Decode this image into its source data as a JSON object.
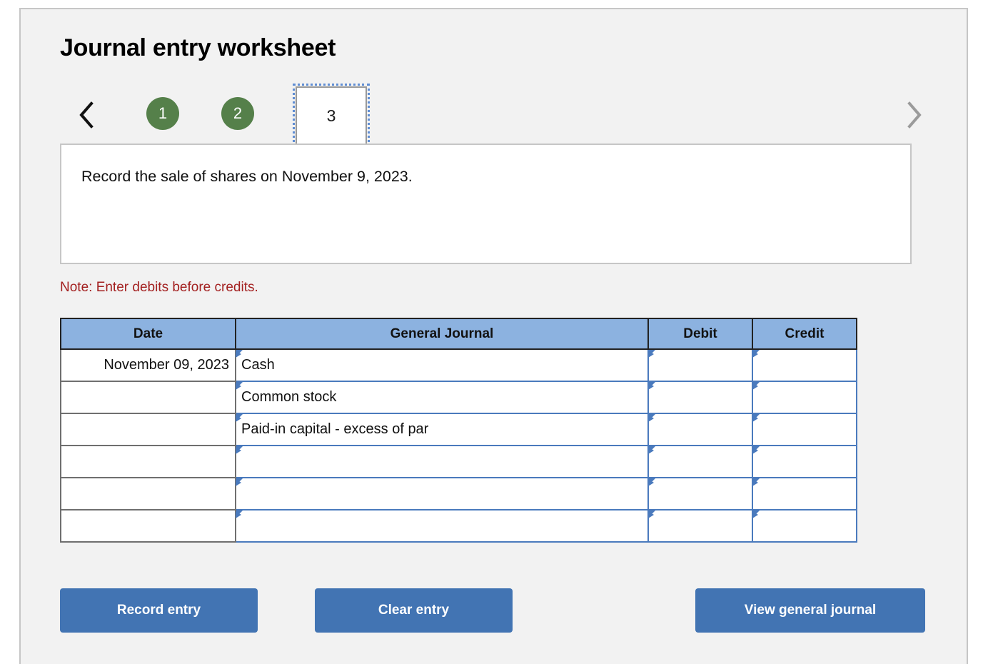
{
  "page": {
    "title": "Journal entry worksheet"
  },
  "tabstrip": {
    "prev_icon": "chevron-left-icon",
    "next_icon": "chevron-right-icon",
    "tabs": [
      {
        "label": "1",
        "state": "complete"
      },
      {
        "label": "2",
        "state": "complete"
      },
      {
        "label": "3",
        "state": "active"
      }
    ],
    "accent_complete": "#55804a",
    "accent_focus": "#5f8dd3"
  },
  "description": {
    "text": "Record the sale of shares on November 9, 2023."
  },
  "note": {
    "text": "Note: Enter debits before credits.",
    "color": "#a32020"
  },
  "journal": {
    "header_color": "#8cb2e0",
    "columns": [
      "Date",
      "General Journal",
      "Debit",
      "Credit"
    ],
    "rows": [
      {
        "date": "November 09, 2023",
        "account": "Cash",
        "debit": "",
        "credit": ""
      },
      {
        "date": "",
        "account": "Common stock",
        "debit": "",
        "credit": ""
      },
      {
        "date": "",
        "account": "Paid-in capital - excess of par",
        "debit": "",
        "credit": ""
      },
      {
        "date": "",
        "account": "",
        "debit": "",
        "credit": ""
      },
      {
        "date": "",
        "account": "",
        "debit": "",
        "credit": ""
      },
      {
        "date": "",
        "account": "",
        "debit": "",
        "credit": ""
      }
    ]
  },
  "actions": {
    "record_label": "Record entry",
    "clear_label": "Clear entry",
    "view_label": "View general journal",
    "button_color": "#4274b3"
  }
}
